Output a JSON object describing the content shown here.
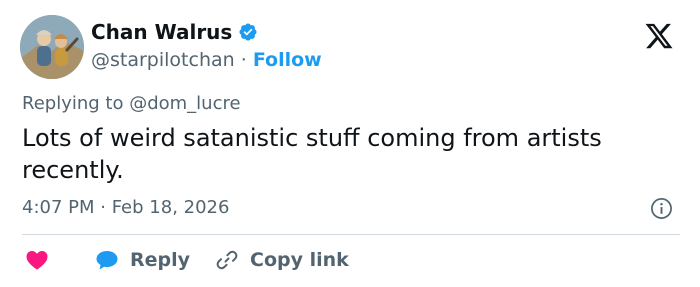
{
  "author": {
    "name": "Chan Walrus",
    "handle": "@starpilotchan",
    "separator": "·",
    "follow_label": "Follow",
    "verified_color": "#1d9bf0"
  },
  "icons": {
    "brand": "x-logo-icon",
    "verified": "verified-badge-icon",
    "info": "info-icon",
    "like": "heart-icon",
    "reply": "speech-bubble-icon",
    "copy": "link-icon"
  },
  "tweet": {
    "replying_to": "Replying to @dom_lucre",
    "text": "Lots of weird satanistic stuff coming from artists recently.",
    "time": "4:07 PM · Feb 18, 2026"
  },
  "actions": {
    "reply_label": "Reply",
    "copy_link_label": "Copy link"
  },
  "colors": {
    "like": "#f91880",
    "reply": "#1d9bf0",
    "secondary_text": "#536471",
    "link": "#1d9bf0"
  }
}
